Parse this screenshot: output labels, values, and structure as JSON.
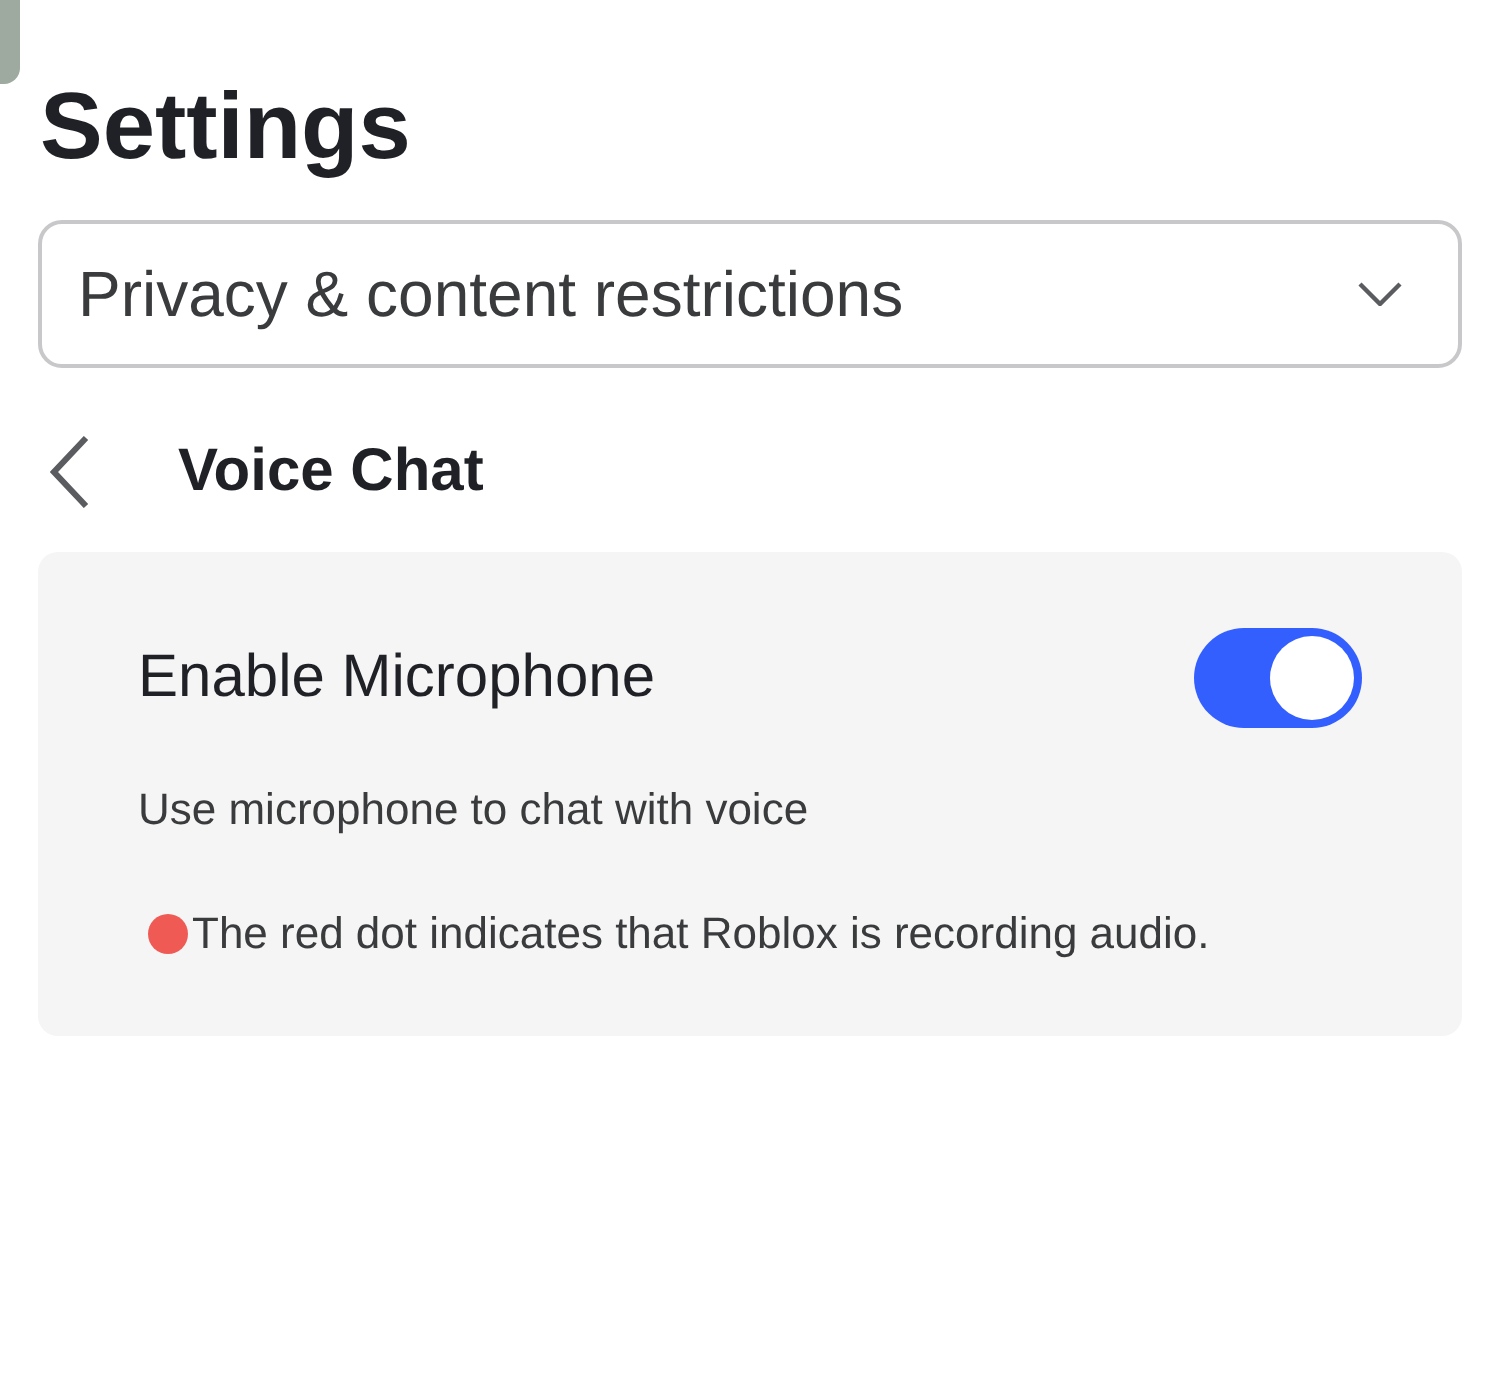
{
  "title": "Settings",
  "category_dropdown": {
    "value": "Privacy & content restrictions"
  },
  "section": {
    "title": "Voice Chat"
  },
  "setting": {
    "label": "Enable Microphone",
    "on": true,
    "description": "Use microphone to chat with voice",
    "note": "The red dot indicates that Roblox is recording audio."
  }
}
